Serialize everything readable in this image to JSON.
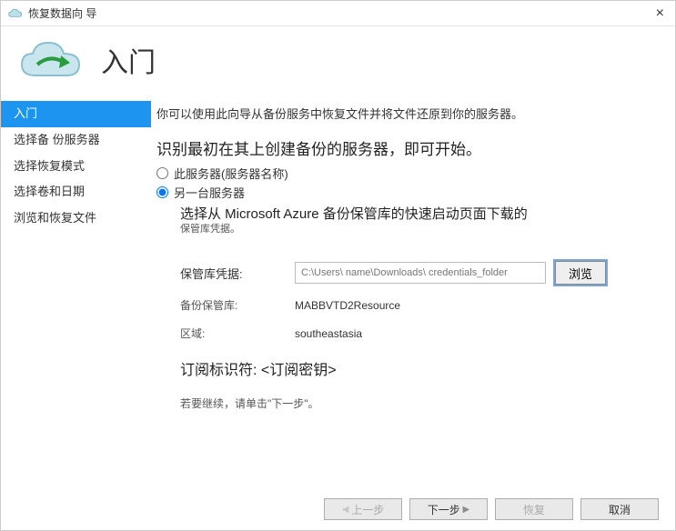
{
  "window": {
    "title": "恢复数据向 导"
  },
  "header": {
    "title": "入门"
  },
  "sidebar": {
    "items": [
      {
        "label": "入门"
      },
      {
        "label": "选择备 份服务器"
      },
      {
        "label": "选择恢复模式"
      },
      {
        "label": "选择卷和日期"
      },
      {
        "label": "浏览和恢复文件"
      }
    ]
  },
  "main": {
    "intro": "你可以使用此向导从备份服务中恢复文件并将文件还原到你的服务器。",
    "section_title": "识别最初在其上创建备份的服务器，即可开始。",
    "radio_this_server": "此服务器(服务器名称)",
    "radio_other_server": "另一台服务器",
    "vault_hint_top": "选择从 Microsoft Azure 备份保管库的快速启动页面下载的",
    "vault_hint_small": "保管库凭据。",
    "cred_label": "保管库凭据:",
    "cred_placeholder": "C:\\Users\\ name\\Downloads\\ credentials_folder",
    "browse_label": "浏览",
    "backup_vault_label": "备份保管库:",
    "backup_vault_value": "MABBVTD2Resource",
    "region_label": "区域:",
    "region_value": "southeastasia",
    "subscription_line": "订阅标识符: <订阅密钥>",
    "continue_hint": "若要继续，请单击\"下一步\"。"
  },
  "footer": {
    "prev": "上一步",
    "next": "下一步",
    "recover": "恢复",
    "cancel": "取消"
  }
}
